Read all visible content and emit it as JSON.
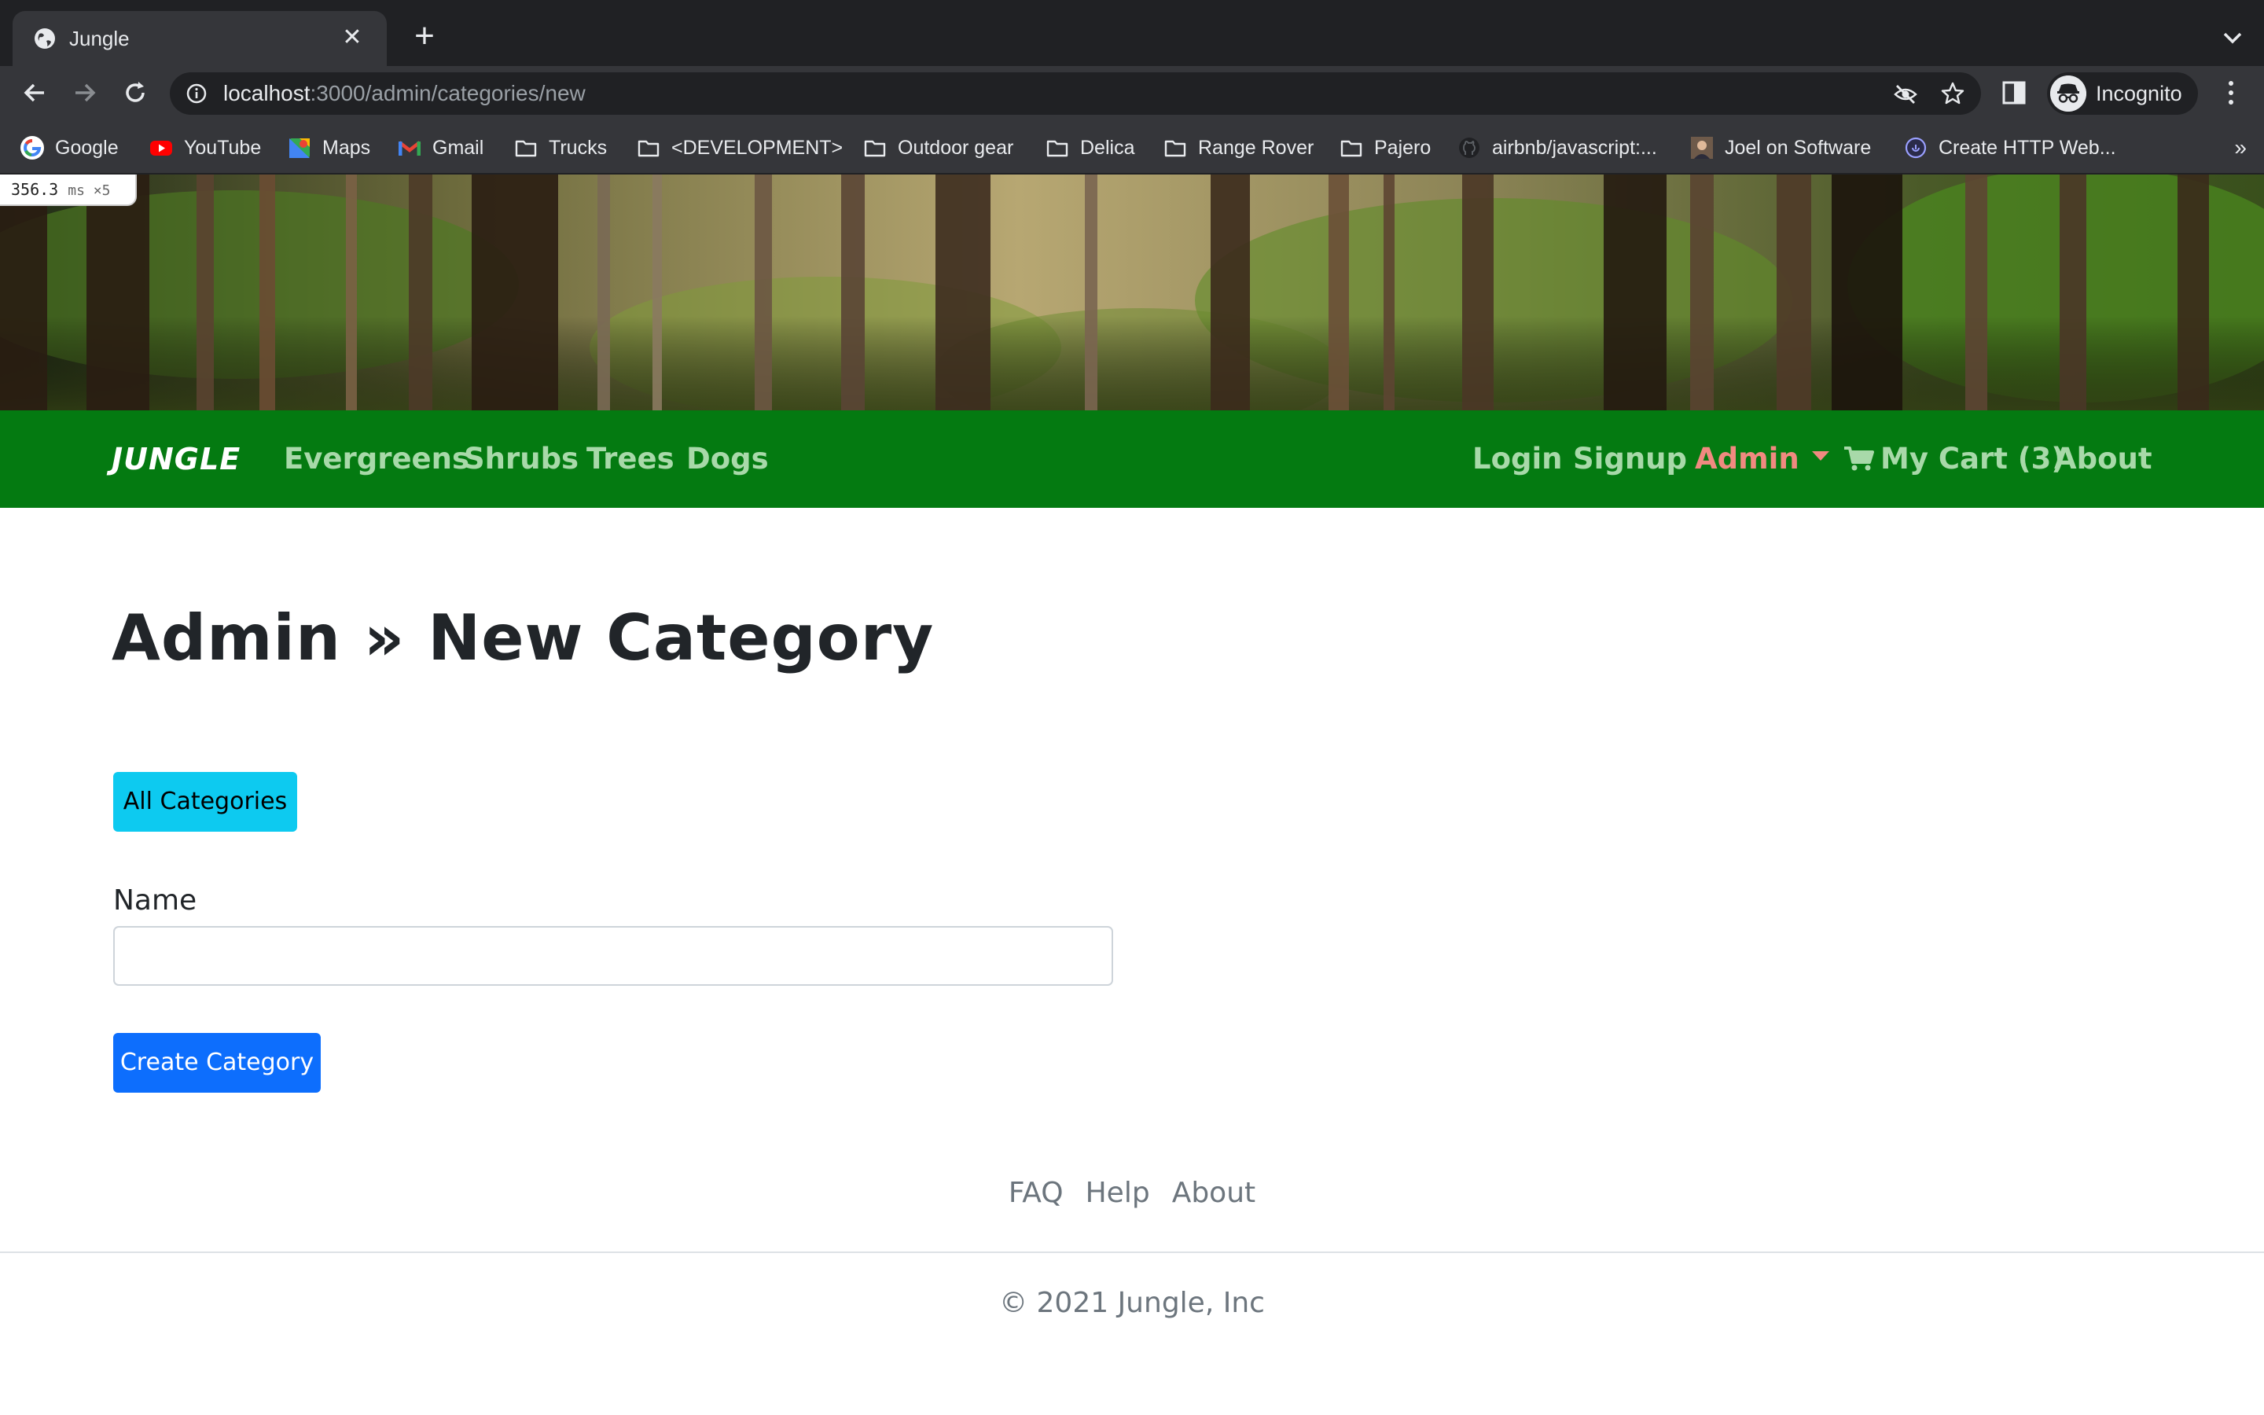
{
  "browser": {
    "tab_title": "Jungle",
    "tab_close": "✕",
    "new_tab": "+",
    "url_host": "localhost",
    "url_path": ":3000/admin/categories/new",
    "profile_label": "Incognito",
    "bookmarks": [
      {
        "label": "Google",
        "icon": "google-icon"
      },
      {
        "label": "YouTube",
        "icon": "youtube-icon"
      },
      {
        "label": "Maps",
        "icon": "maps-icon"
      },
      {
        "label": "Gmail",
        "icon": "gmail-icon"
      },
      {
        "label": "Trucks",
        "icon": "folder-icon"
      },
      {
        "label": "<DEVELOPMENT>",
        "icon": "folder-icon"
      },
      {
        "label": "Outdoor gear",
        "icon": "folder-icon"
      },
      {
        "label": "Delica",
        "icon": "folder-icon"
      },
      {
        "label": "Range Rover",
        "icon": "folder-icon"
      },
      {
        "label": "Pajero",
        "icon": "folder-icon"
      },
      {
        "label": "airbnb/javascript:...",
        "icon": "github-icon"
      },
      {
        "label": "Joel on Software",
        "icon": "avatar-icon"
      },
      {
        "label": "Create HTTP Web...",
        "icon": "web-icon"
      }
    ],
    "bookmarks_overflow": "»"
  },
  "perf_badge": {
    "value": "356.3",
    "unit": "ms ×5"
  },
  "navbar": {
    "brand": "JUNGLE",
    "left_links": [
      "Evergreens",
      "Shrubs",
      "Trees",
      "Dogs"
    ],
    "login": "Login",
    "signup": "Signup",
    "admin": "Admin",
    "cart": "My Cart (3)",
    "about": "About"
  },
  "page": {
    "title": "Admin » New Category",
    "all_categories_button": "All Categories",
    "name_label": "Name",
    "name_value": "",
    "create_button": "Create Category"
  },
  "footer": {
    "links": [
      "FAQ",
      "Help",
      "About"
    ],
    "copyright": "© 2021 Jungle, Inc"
  },
  "colors": {
    "navbar_bg": "#047a11",
    "nav_link": "#a8d9a9",
    "nav_admin": "#f08a80",
    "info_button": "#0dcaf0",
    "primary_button": "#0d6efd"
  }
}
